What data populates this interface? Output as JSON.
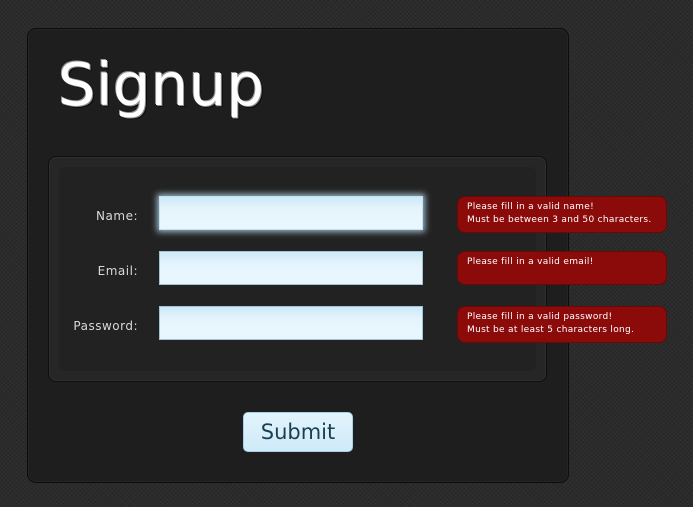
{
  "form": {
    "title": "Signup",
    "fields": [
      {
        "label": "Name:",
        "value": "",
        "error_lines": [
          "Please fill in a valid name!",
          "Must be between 3 and 50 characters."
        ]
      },
      {
        "label": "Email:",
        "value": "",
        "error_lines": [
          "Please fill in a valid email!"
        ]
      },
      {
        "label": "Password:",
        "value": "",
        "error_lines": [
          "Please fill in a valid password!",
          "Must be at least 5 characters long."
        ]
      }
    ],
    "submit_label": "Submit"
  },
  "colors": {
    "panel_background": "#1e1e1e",
    "error_background": "#8b0b0b",
    "input_background": "#e6f5fd"
  }
}
